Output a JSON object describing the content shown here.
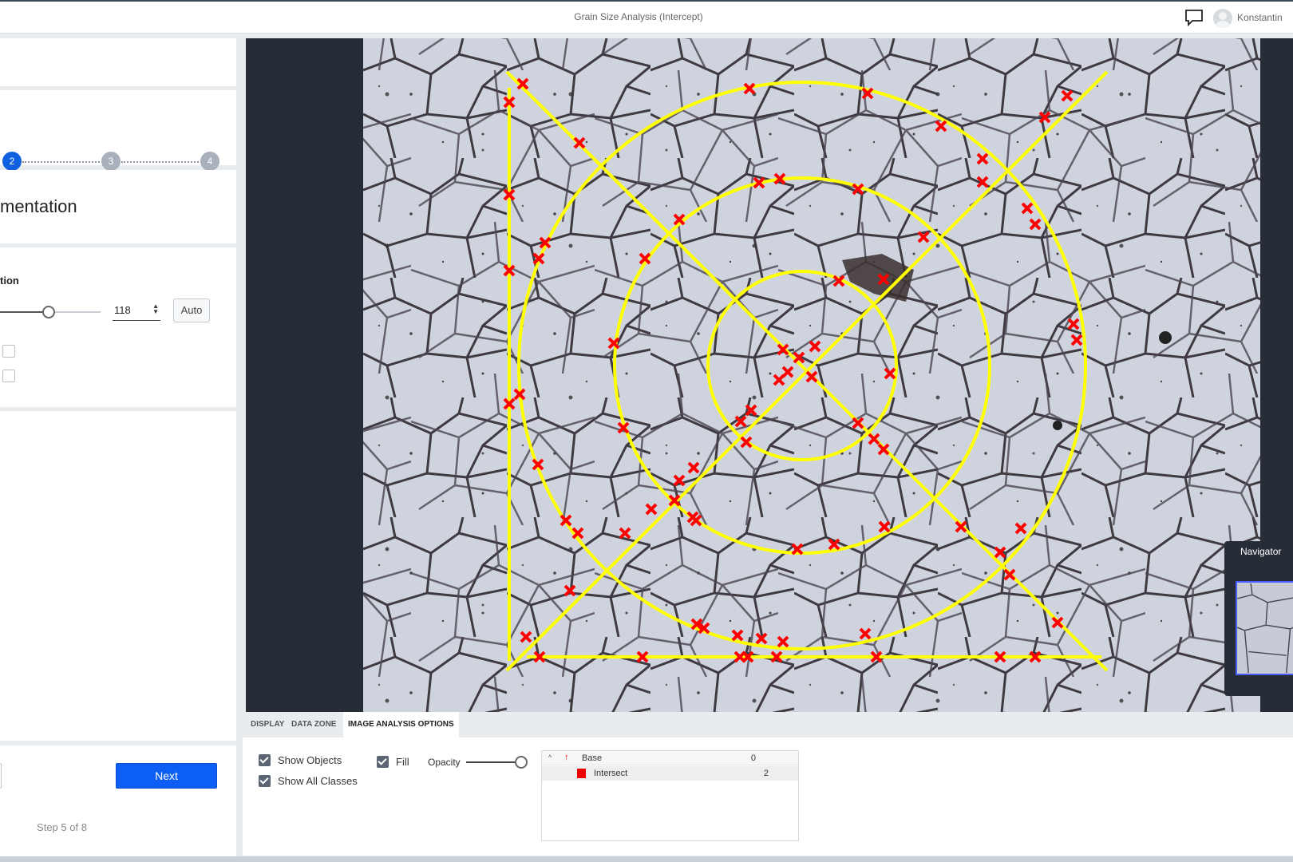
{
  "titlebar": {
    "title": "Grain Size Analysis (Intercept)",
    "user_name": "Konstantin",
    "icons": [
      "chat-icon",
      "avatar-icon"
    ]
  },
  "stepper": {
    "steps": [
      {
        "label": "2",
        "state": "active"
      },
      {
        "label": "3",
        "state": "pending"
      },
      {
        "label": "4",
        "state": "pending"
      }
    ],
    "active_color": "#1060e0",
    "pending_color": "#a8b0bb"
  },
  "section": {
    "title": "mentation",
    "subsection_label": "tion",
    "threshold_value": "118",
    "threshold_fraction": 0.47,
    "auto_label": "Auto"
  },
  "footer": {
    "next_label": "Next",
    "step_count": "Step 5 of 8",
    "accent_color": "#0d5ef5"
  },
  "viewer": {
    "overlay_color": "#ffff00",
    "marker_color": "#ff0000",
    "navigator_title": "Navigator"
  },
  "bottom": {
    "tabs": [
      {
        "label": "DISPLAY",
        "active": false
      },
      {
        "label": "DATA ZONE",
        "active": false
      },
      {
        "label": "IMAGE ANALYSIS OPTIONS",
        "active": true
      }
    ],
    "show_objects_label": "Show Objects",
    "show_objects_checked": true,
    "show_all_classes_label": "Show All Classes",
    "show_all_classes_checked": true,
    "fill_label": "Fill",
    "fill_checked": true,
    "opacity_label": "Opacity",
    "opacity_fraction": 1.0,
    "classes": [
      {
        "name": "Base",
        "count": "0"
      },
      {
        "name": "Intersect",
        "count": "2",
        "color": "#ee0000"
      }
    ]
  }
}
